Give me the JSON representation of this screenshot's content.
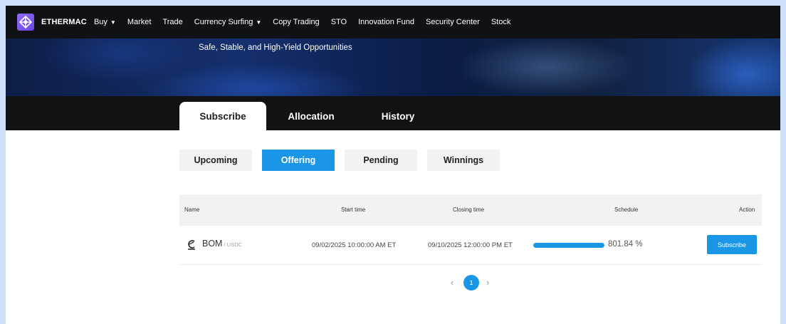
{
  "nav": {
    "brand": "ETHERMAC",
    "items": [
      {
        "label": "Buy",
        "dropdown": true
      },
      {
        "label": "Market",
        "dropdown": false
      },
      {
        "label": "Trade",
        "dropdown": false
      },
      {
        "label": "Currency Surfing",
        "dropdown": true
      },
      {
        "label": "Copy Trading",
        "dropdown": false
      },
      {
        "label": "STO",
        "dropdown": false
      },
      {
        "label": "Innovation Fund",
        "dropdown": false
      },
      {
        "label": "Security Center",
        "dropdown": false
      },
      {
        "label": "Stock",
        "dropdown": false
      }
    ]
  },
  "banner": {
    "tagline": "Safe, Stable, and High-Yield Opportunities"
  },
  "main_tabs": [
    {
      "label": "Subscribe",
      "active": true
    },
    {
      "label": "Allocation",
      "active": false
    },
    {
      "label": "History",
      "active": false
    }
  ],
  "sub_tabs": [
    {
      "label": "Upcoming",
      "active": false
    },
    {
      "label": "Offering",
      "active": true
    },
    {
      "label": "Pending",
      "active": false
    },
    {
      "label": "Winnings",
      "active": false
    }
  ],
  "table": {
    "headers": {
      "name": "Name",
      "start": "Start time",
      "closing": "Closing time",
      "schedule": "Schedule",
      "action": "Action"
    },
    "rows": [
      {
        "base": "BOM",
        "quote": "/ USDC",
        "start_time": "09/02/2025 10:00:00 AM ET",
        "closing_time": "09/10/2025 12:00:00 PM ET",
        "schedule_fraction": 1.0,
        "schedule_text": "801.84 %",
        "action_label": "Subscribe"
      }
    ]
  },
  "pagination": {
    "current_page": "1",
    "prev_glyph": "‹",
    "next_glyph": "›"
  },
  "colors": {
    "accent": "#1a96e6",
    "nav_bg": "#0f1115",
    "tabbar_bg": "#121212",
    "logo": "#7b57ee"
  },
  "icons": {
    "logo": "ethermac-logo-icon",
    "coin": "bom-coin-icon",
    "caret": "caret-down-icon"
  }
}
